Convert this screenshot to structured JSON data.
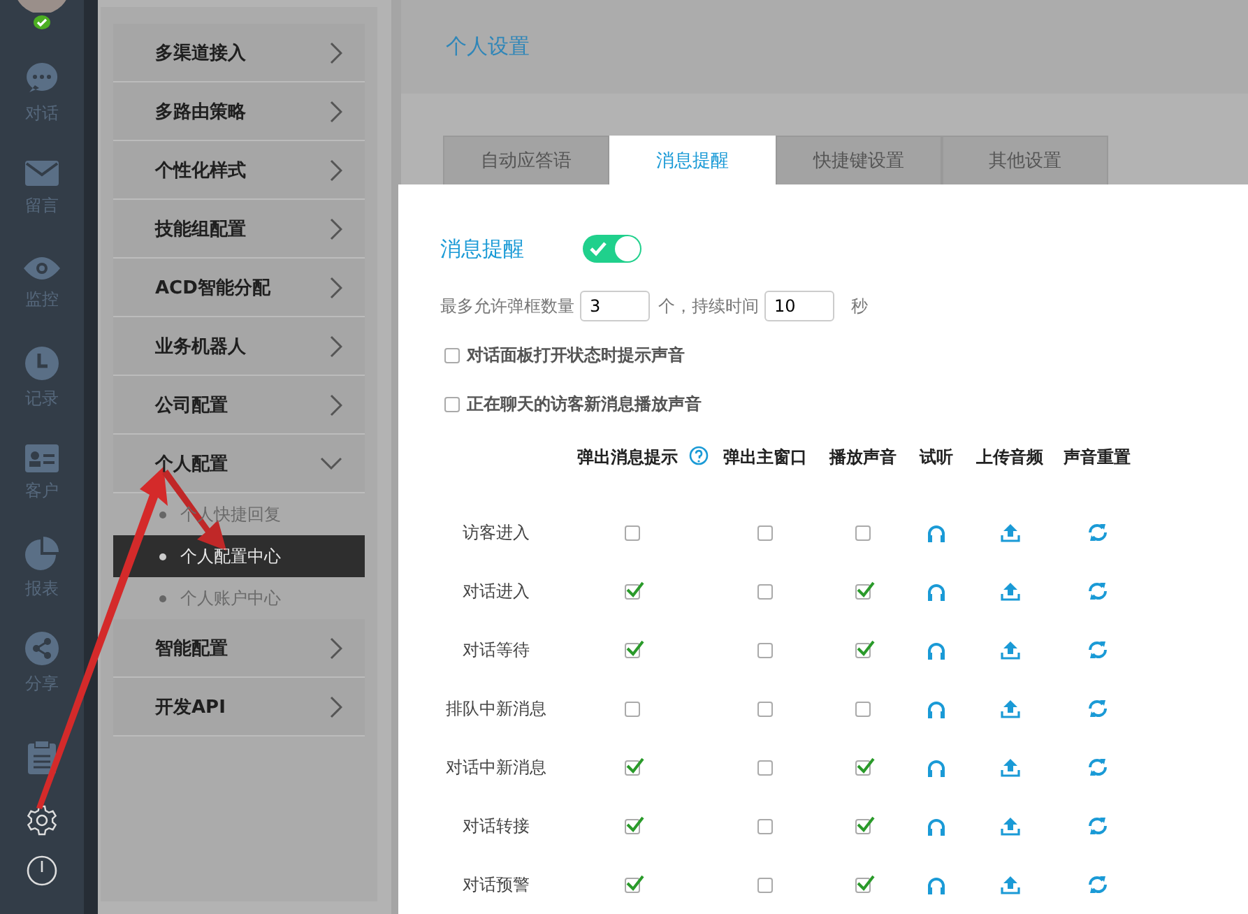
{
  "sidebar": {
    "items": [
      {
        "label": "对话"
      },
      {
        "label": "留言"
      },
      {
        "label": "监控"
      },
      {
        "label": "记录"
      },
      {
        "label": "客户"
      },
      {
        "label": "报表"
      },
      {
        "label": "分享"
      }
    ]
  },
  "menu": {
    "items": [
      {
        "label": "多渠道接入",
        "expanded": false
      },
      {
        "label": "多路由策略",
        "expanded": false
      },
      {
        "label": "个性化样式",
        "expanded": false
      },
      {
        "label": "技能组配置",
        "expanded": false
      },
      {
        "label": "ACD智能分配",
        "expanded": false
      },
      {
        "label": "业务机器人",
        "expanded": false
      },
      {
        "label": "公司配置",
        "expanded": false
      },
      {
        "label": "个人配置",
        "expanded": true,
        "children": [
          {
            "label": "个人快捷回复",
            "selected": false
          },
          {
            "label": "个人配置中心",
            "selected": true
          },
          {
            "label": "个人账户中心",
            "selected": false
          }
        ]
      },
      {
        "label": "智能配置",
        "expanded": false
      },
      {
        "label": "开发API",
        "expanded": false
      }
    ]
  },
  "header": {
    "title": "个人设置"
  },
  "tabs": [
    {
      "label": "自动应答语",
      "selected": false
    },
    {
      "label": "消息提醒",
      "selected": true
    },
    {
      "label": "快捷键设置",
      "selected": false
    },
    {
      "label": "其他设置",
      "selected": false
    }
  ],
  "notify": {
    "label": "消息提醒",
    "on": true
  },
  "limit": {
    "prefix": "最多允许弹框数量",
    "count": "3",
    "middle": "个，持续时间",
    "duration": "10",
    "suffix": "秒"
  },
  "options": [
    {
      "label": "对话面板打开状态时提示声音",
      "checked": false
    },
    {
      "label": "正在聊天的访客新消息播放声音",
      "checked": false
    }
  ],
  "table": {
    "columns": [
      "弹出消息提示",
      "弹出主窗口",
      "播放声音",
      "试听",
      "上传音频",
      "声音重置"
    ],
    "rows": [
      {
        "label": "访客进入",
        "popup": false,
        "main_window": false,
        "sound": false
      },
      {
        "label": "对话进入",
        "popup": true,
        "main_window": false,
        "sound": true
      },
      {
        "label": "对话等待",
        "popup": true,
        "main_window": false,
        "sound": true
      },
      {
        "label": "排队中新消息",
        "popup": false,
        "main_window": false,
        "sound": false
      },
      {
        "label": "对话中新消息",
        "popup": true,
        "main_window": false,
        "sound": true
      },
      {
        "label": "对话转接",
        "popup": true,
        "main_window": false,
        "sound": true
      },
      {
        "label": "对话预警",
        "popup": true,
        "main_window": false,
        "sound": true
      }
    ]
  }
}
